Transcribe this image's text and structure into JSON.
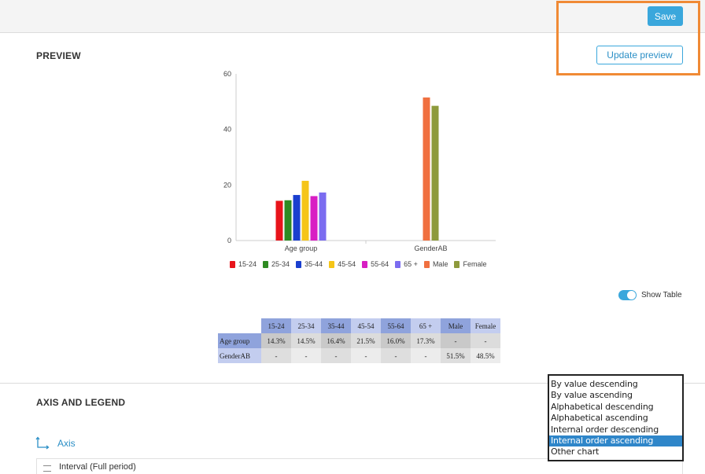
{
  "toolbar": {
    "save_label": "Save"
  },
  "preview": {
    "title": "PREVIEW",
    "update_label": "Update preview"
  },
  "colors": {
    "accent": "#3aa7dc",
    "highlight": "#f08a35"
  },
  "chart_data": {
    "type": "bar",
    "categories": [
      "Age group",
      "GenderAB"
    ],
    "ylim": [
      0,
      60
    ],
    "yticks": [
      0,
      20,
      40,
      60
    ],
    "grid": false,
    "legend_position": "bottom",
    "series": [
      {
        "name": "15-24",
        "color": "#e8141b",
        "values": [
          14.3,
          null
        ]
      },
      {
        "name": "25-34",
        "color": "#2e8b22",
        "values": [
          14.5,
          null
        ]
      },
      {
        "name": "35-44",
        "color": "#1a3fcf",
        "values": [
          16.4,
          null
        ]
      },
      {
        "name": "45-54",
        "color": "#f5c518",
        "values": [
          21.5,
          null
        ]
      },
      {
        "name": "55-64",
        "color": "#d81ec3",
        "values": [
          16.0,
          null
        ]
      },
      {
        "name": "65 +",
        "color": "#7b6cf0",
        "values": [
          17.3,
          null
        ]
      },
      {
        "name": "Male",
        "color": "#f07040",
        "values": [
          null,
          51.5
        ]
      },
      {
        "name": "Female",
        "color": "#8e9a3c",
        "values": [
          null,
          48.5
        ]
      }
    ]
  },
  "show_table": {
    "label": "Show Table",
    "on": true
  },
  "table": {
    "headers": [
      "15-24",
      "25-34",
      "35-44",
      "45-54",
      "55-64",
      "65 +",
      "Male",
      "Female"
    ],
    "rows": [
      {
        "label": "Age group",
        "cells": [
          "14.3%",
          "14.5%",
          "16.4%",
          "21.5%",
          "16.0%",
          "17.3%",
          "-",
          "-"
        ]
      },
      {
        "label": "GenderAB",
        "cells": [
          "-",
          "-",
          "-",
          "-",
          "-",
          "-",
          "51.5%",
          "48.5%"
        ]
      }
    ]
  },
  "axis_legend": {
    "title": "AXIS AND LEGEND",
    "axis_label": "Axis",
    "interval_label": "Interval (Full period)"
  },
  "sort_dropdown": {
    "options": [
      "By value descending",
      "By value ascending",
      "Alphabetical descending",
      "Alphabetical ascending",
      "Internal order descending",
      "Internal order ascending",
      "Other chart"
    ],
    "selected_index": 5
  }
}
